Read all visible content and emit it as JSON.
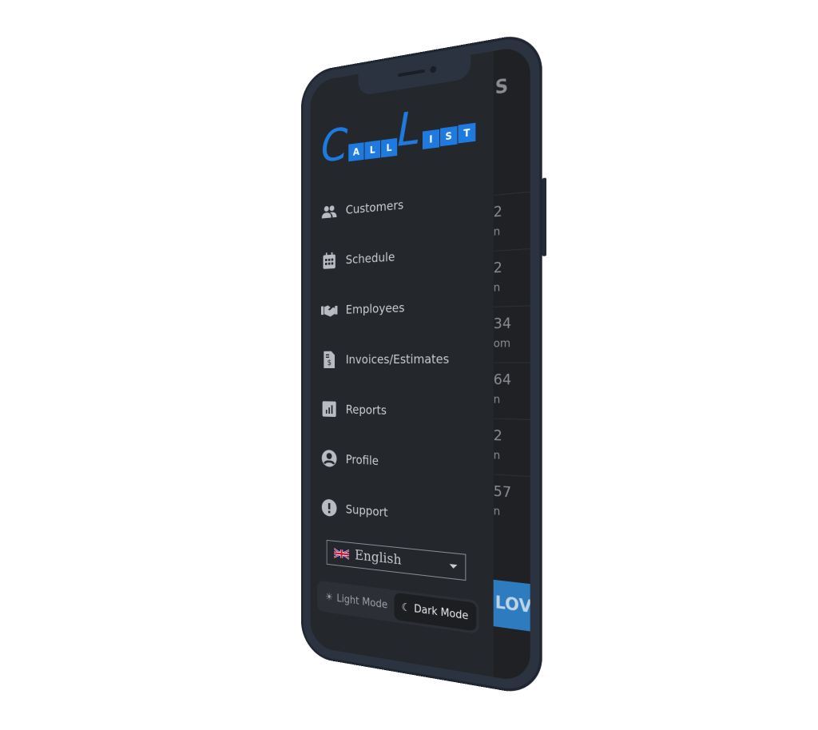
{
  "app": {
    "logo_text": "CallList",
    "logo_big_1": "C",
    "logo_small_1": [
      "A",
      "L",
      "L"
    ],
    "logo_big_2": "L",
    "logo_small_2": [
      "I",
      "S",
      "T"
    ],
    "brand_color": "#1f7ae0"
  },
  "sidebar": {
    "items": [
      {
        "label": "Customers",
        "icon": "users-icon"
      },
      {
        "label": "Schedule",
        "icon": "calendar-icon"
      },
      {
        "label": "Employees",
        "icon": "handshake-icon"
      },
      {
        "label": "Invoices/Estimates",
        "icon": "invoice-icon"
      },
      {
        "label": "Reports",
        "icon": "chart-icon"
      },
      {
        "label": "Profile",
        "icon": "user-circle-icon"
      },
      {
        "label": "Support",
        "icon": "exclamation-circle-icon"
      }
    ],
    "language": {
      "selected": "English",
      "flag": "uk-flag-icon"
    },
    "theme": {
      "light_label": "Light Mode",
      "dark_label": "Dark Mode",
      "selected": "Dark Mode"
    }
  },
  "background": {
    "header_fragment": "S",
    "rows": [
      {
        "num": "2",
        "sub": "n"
      },
      {
        "num": "2",
        "sub": "n"
      },
      {
        "num": "34",
        "sub": "om"
      },
      {
        "num": "64",
        "sub": "n"
      },
      {
        "num": "2",
        "sub": "n"
      },
      {
        "num": "57",
        "sub": "n"
      }
    ],
    "button_fragment": "LOV"
  }
}
